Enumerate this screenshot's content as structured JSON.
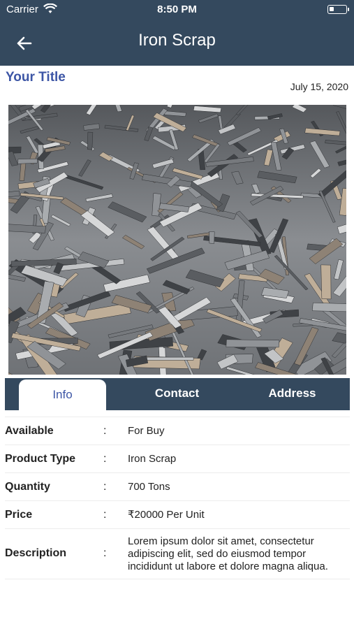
{
  "status": {
    "carrier": "Carrier",
    "time": "8:50 PM"
  },
  "nav": {
    "title": "Iron Scrap"
  },
  "post": {
    "title": "Your Title",
    "date": "July 15, 2020"
  },
  "tabs": [
    {
      "label": "Info",
      "active": true
    },
    {
      "label": "Contact",
      "active": false
    },
    {
      "label": "Address",
      "active": false
    }
  ],
  "details": [
    {
      "label": "Available",
      "colon": ":",
      "value": "For Buy"
    },
    {
      "label": "Product Type",
      "colon": ":",
      "value": "Iron Scrap"
    },
    {
      "label": "Quantity",
      "colon": ":",
      "value": "700  Tons"
    },
    {
      "label": "Price",
      "colon": ":",
      "value": "₹20000  Per Unit"
    },
    {
      "label": "Description",
      "colon": ":",
      "value": "Lorem ipsum dolor sit amet, consectetur adipiscing elit, sed do eiusmod tempor incididunt ut labore et dolore magna aliqua."
    }
  ],
  "colors": {
    "header": "#34495e",
    "accent": "#3d56a6"
  }
}
